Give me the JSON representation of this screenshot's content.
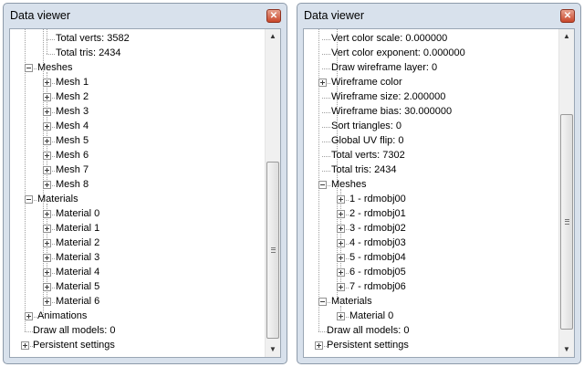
{
  "windows": [
    {
      "title": "Data viewer",
      "rows": [
        {
          "label": "Total verts: 3582",
          "level": 2,
          "exp": null,
          "nameId": "tree-item-total-verts"
        },
        {
          "label": "Total tris: 2434",
          "level": 2,
          "exp": null,
          "nameId": "tree-item-total-tris"
        },
        {
          "label": "Meshes",
          "level": 1,
          "exp": "minus",
          "nameId": "tree-item-meshes"
        },
        {
          "label": "Mesh 1",
          "level": 2,
          "exp": "plus",
          "nameId": "tree-item-mesh"
        },
        {
          "label": "Mesh 2",
          "level": 2,
          "exp": "plus",
          "nameId": "tree-item-mesh"
        },
        {
          "label": "Mesh 3",
          "level": 2,
          "exp": "plus",
          "nameId": "tree-item-mesh"
        },
        {
          "label": "Mesh 4",
          "level": 2,
          "exp": "plus",
          "nameId": "tree-item-mesh"
        },
        {
          "label": "Mesh 5",
          "level": 2,
          "exp": "plus",
          "nameId": "tree-item-mesh"
        },
        {
          "label": "Mesh 6",
          "level": 2,
          "exp": "plus",
          "nameId": "tree-item-mesh"
        },
        {
          "label": "Mesh 7",
          "level": 2,
          "exp": "plus",
          "nameId": "tree-item-mesh"
        },
        {
          "label": "Mesh 8",
          "level": 2,
          "exp": "plus",
          "nameId": "tree-item-mesh"
        },
        {
          "label": "Materials",
          "level": 1,
          "exp": "minus",
          "nameId": "tree-item-materials"
        },
        {
          "label": "Material 0",
          "level": 2,
          "exp": "plus",
          "nameId": "tree-item-material"
        },
        {
          "label": "Material 1",
          "level": 2,
          "exp": "plus",
          "nameId": "tree-item-material"
        },
        {
          "label": "Material 2",
          "level": 2,
          "exp": "plus",
          "nameId": "tree-item-material"
        },
        {
          "label": "Material 3",
          "level": 2,
          "exp": "plus",
          "nameId": "tree-item-material"
        },
        {
          "label": "Material 4",
          "level": 2,
          "exp": "plus",
          "nameId": "tree-item-material"
        },
        {
          "label": "Material 5",
          "level": 2,
          "exp": "plus",
          "nameId": "tree-item-material"
        },
        {
          "label": "Material 6",
          "level": 2,
          "exp": "plus",
          "nameId": "tree-item-material"
        },
        {
          "label": "Animations",
          "level": 1,
          "exp": "plus",
          "nameId": "tree-item-animations"
        },
        {
          "label": "Draw all models: 0",
          "level": 0,
          "exp": null,
          "nameId": "tree-item-draw-all-models"
        },
        {
          "label": "Persistent settings",
          "level": -1,
          "exp": "plus",
          "nameId": "tree-item-persistent-settings"
        }
      ]
    },
    {
      "title": "Data viewer",
      "rows": [
        {
          "label": "Vert color scale: 0.000000",
          "level": 1,
          "exp": null,
          "nameId": "tree-item-vert-color-scale"
        },
        {
          "label": "Vert color exponent: 0.000000",
          "level": 1,
          "exp": null,
          "nameId": "tree-item-vert-color-exponent"
        },
        {
          "label": "Draw wireframe layer: 0",
          "level": 1,
          "exp": null,
          "nameId": "tree-item-draw-wireframe-layer"
        },
        {
          "label": "Wireframe color",
          "level": 1,
          "exp": "plus",
          "nameId": "tree-item-wireframe-color"
        },
        {
          "label": "Wireframe size: 2.000000",
          "level": 1,
          "exp": null,
          "nameId": "tree-item-wireframe-size"
        },
        {
          "label": "Wireframe bias: 30.000000",
          "level": 1,
          "exp": null,
          "nameId": "tree-item-wireframe-bias"
        },
        {
          "label": "Sort triangles: 0",
          "level": 1,
          "exp": null,
          "nameId": "tree-item-sort-triangles"
        },
        {
          "label": "Global UV flip: 0",
          "level": 1,
          "exp": null,
          "nameId": "tree-item-global-uv-flip"
        },
        {
          "label": "Total verts: 7302",
          "level": 1,
          "exp": null,
          "nameId": "tree-item-total-verts"
        },
        {
          "label": "Total tris: 2434",
          "level": 1,
          "exp": null,
          "nameId": "tree-item-total-tris"
        },
        {
          "label": "Meshes",
          "level": 1,
          "exp": "minus",
          "nameId": "tree-item-meshes"
        },
        {
          "label": "1 - rdmobj00",
          "level": 2,
          "exp": "plus",
          "nameId": "tree-item-mesh"
        },
        {
          "label": "2 - rdmobj01",
          "level": 2,
          "exp": "plus",
          "nameId": "tree-item-mesh"
        },
        {
          "label": "3 - rdmobj02",
          "level": 2,
          "exp": "plus",
          "nameId": "tree-item-mesh"
        },
        {
          "label": "4 - rdmobj03",
          "level": 2,
          "exp": "plus",
          "nameId": "tree-item-mesh"
        },
        {
          "label": "5 - rdmobj04",
          "level": 2,
          "exp": "plus",
          "nameId": "tree-item-mesh"
        },
        {
          "label": "6 - rdmobj05",
          "level": 2,
          "exp": "plus",
          "nameId": "tree-item-mesh"
        },
        {
          "label": "7 - rdmobj06",
          "level": 2,
          "exp": "plus",
          "nameId": "tree-item-mesh"
        },
        {
          "label": "Materials",
          "level": 1,
          "exp": "minus",
          "nameId": "tree-item-materials"
        },
        {
          "label": "Material 0",
          "level": 2,
          "exp": "plus",
          "nameId": "tree-item-material"
        },
        {
          "label": "Draw all models: 0",
          "level": 0,
          "exp": null,
          "nameId": "tree-item-draw-all-models"
        },
        {
          "label": "Persistent settings",
          "level": -1,
          "exp": "plus",
          "nameId": "tree-item-persistent-settings"
        }
      ]
    }
  ],
  "icons": {
    "close": "close-icon",
    "scroll_up": "scroll-up-arrow-icon",
    "scroll_down": "scroll-down-arrow-icon"
  },
  "colors": {
    "titlebar": "#d8e1ec",
    "close_button": "#c9472a",
    "tree_lines": "#a0a0a0"
  }
}
